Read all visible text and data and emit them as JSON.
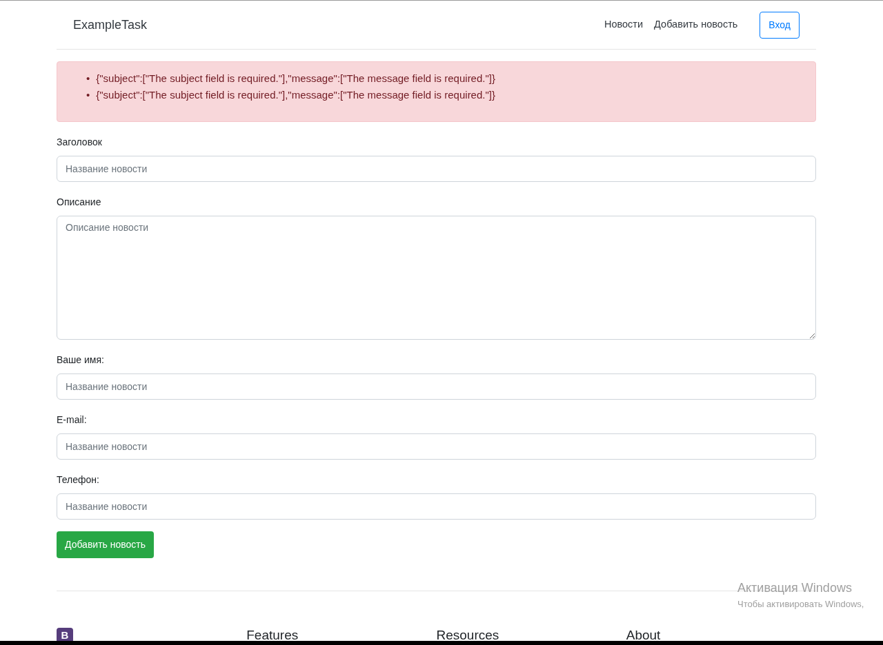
{
  "navbar": {
    "brand": "ExampleTask",
    "links": [
      "Новости",
      "Добавить новость"
    ],
    "login_button": "Вход"
  },
  "alert": {
    "errors": [
      {
        "marker": "•",
        "text": "{\"subject\":[\"The subject field is required.\"],\"message\":[\"The message field is required.\"]}"
      },
      {
        "marker": "•",
        "text": "{\"subject\":[\"The subject field is required.\"],\"message\":[\"The message field is required.\"]}"
      }
    ]
  },
  "form": {
    "fields": [
      {
        "kind": "input",
        "label": "Заголовок",
        "placeholder": "Название новости"
      },
      {
        "kind": "textarea",
        "label": "Описание",
        "placeholder": "Описание новости"
      },
      {
        "kind": "input",
        "label": "Ваше имя:",
        "placeholder": "Название новости"
      },
      {
        "kind": "input",
        "label": "E-mail:",
        "placeholder": "Название новости"
      },
      {
        "kind": "input",
        "label": "Телефон:",
        "placeholder": "Название новости"
      }
    ],
    "submit_button": "Добавить новость"
  },
  "footer": {
    "logo_letter": "B",
    "headings": [
      "Features",
      "Resources",
      "About"
    ]
  },
  "os_notice": {
    "title": "Активация Windows",
    "text": "Чтобы активировать Windows,"
  }
}
